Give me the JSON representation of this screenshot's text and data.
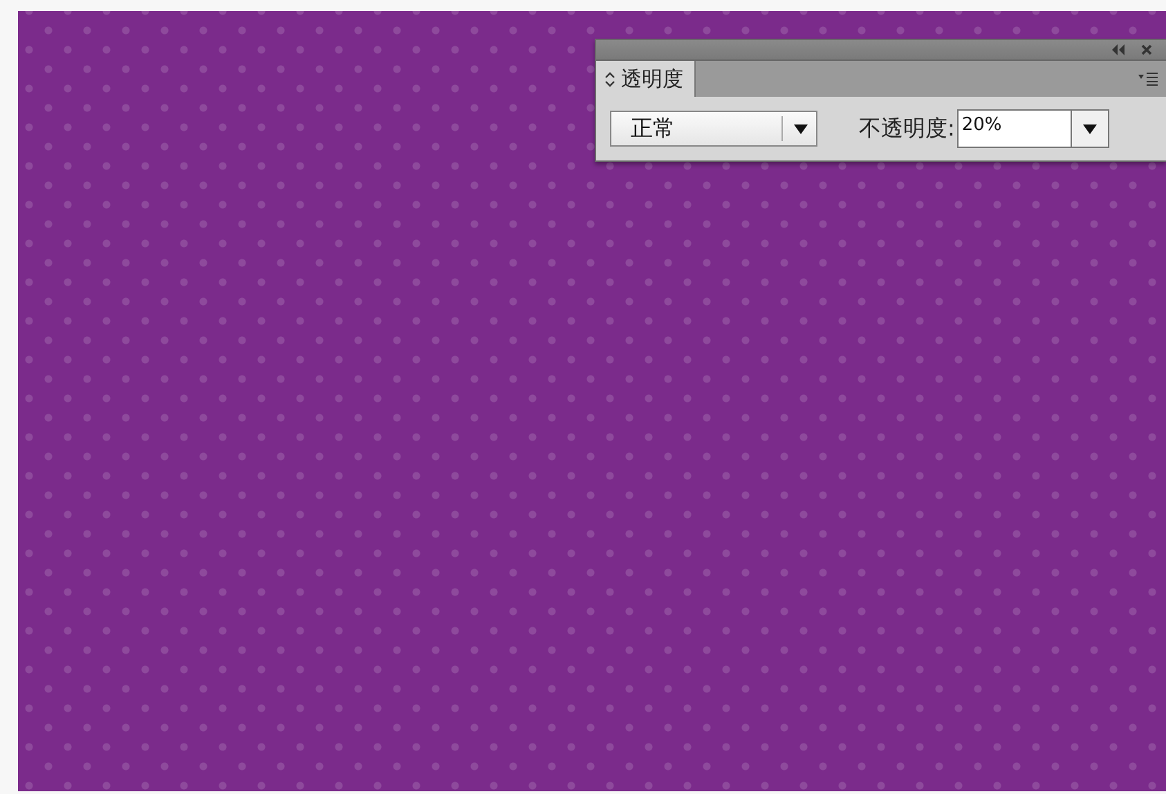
{
  "panel": {
    "tabs": [
      {
        "label": "透明度",
        "selected": true
      }
    ],
    "blend_mode": {
      "value": "正常"
    },
    "opacity": {
      "label": "不透明度:",
      "value": "20%"
    }
  }
}
